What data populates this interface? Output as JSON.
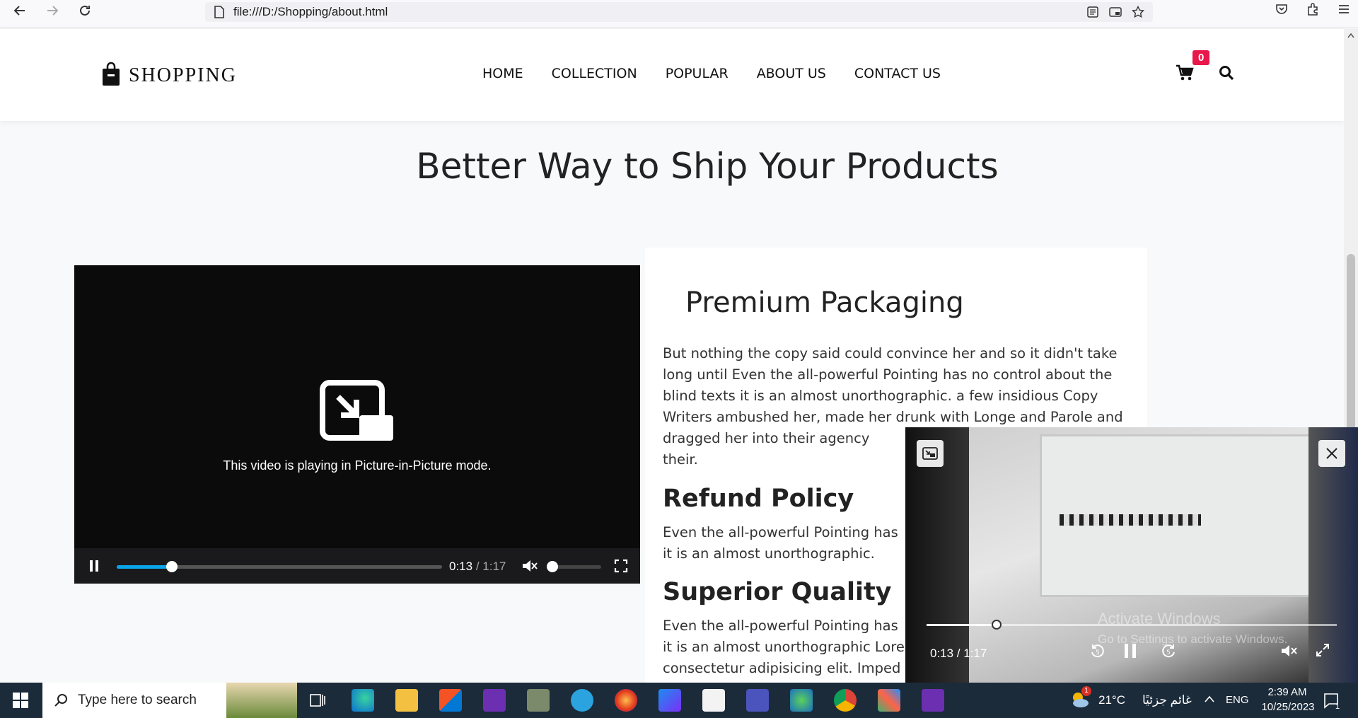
{
  "browser": {
    "url": "file:///D:/Shopping/about.html"
  },
  "header": {
    "logo_text": "SHOPPING",
    "nav": [
      "HOME",
      "COLLECTION",
      "POPULAR",
      "ABOUT US",
      "CONTACT US"
    ],
    "cart_count": "0"
  },
  "page": {
    "title": "Better Way to Ship Your Products"
  },
  "video": {
    "pip_message": "This video is playing in Picture-in-Picture mode.",
    "current_time": "0:13",
    "separator": "/",
    "duration": "1:17",
    "progress": 0.17,
    "volume": 0.0
  },
  "content": {
    "heading": "Premium Packaging",
    "paragraph1": "But nothing the copy said could convince her and so it didn't take long until Even the all-powerful Pointing has no control about the blind texts it is an almost unorthographic. a few insidious Copy Writers ambushed her, made her drunk with Longe and Parole and dragged her into their agency",
    "paragraph1_tail": "their.",
    "section2_title": "Refund Policy",
    "section2_line1": "Even the all-powerful Pointing has",
    "section2_line2": "it is an almost unorthographic.",
    "section3_title": "Superior Quality",
    "section3_line1": "Even the all-powerful Pointing has",
    "section3_line2": "it is an almost unorthographic Lore",
    "section3_line3": "consectetur adipisicing elit. Imped"
  },
  "pip": {
    "time": "0:13 / 1:17",
    "progress": 0.17,
    "watermark_title": "Activate Windows",
    "watermark_sub": "Go to Settings to activate Windows."
  },
  "taskbar": {
    "search_placeholder": "Type here to search",
    "weather_temp": "21°C",
    "weather_text": "غائم جزئيًا",
    "language": "ENG",
    "time": "2:39 AM",
    "date": "10/25/2023",
    "notification_count": "1",
    "weather_alert": "1"
  },
  "colors": {
    "accent_blue": "#0aa4e8",
    "badge_red": "#e8184b"
  }
}
